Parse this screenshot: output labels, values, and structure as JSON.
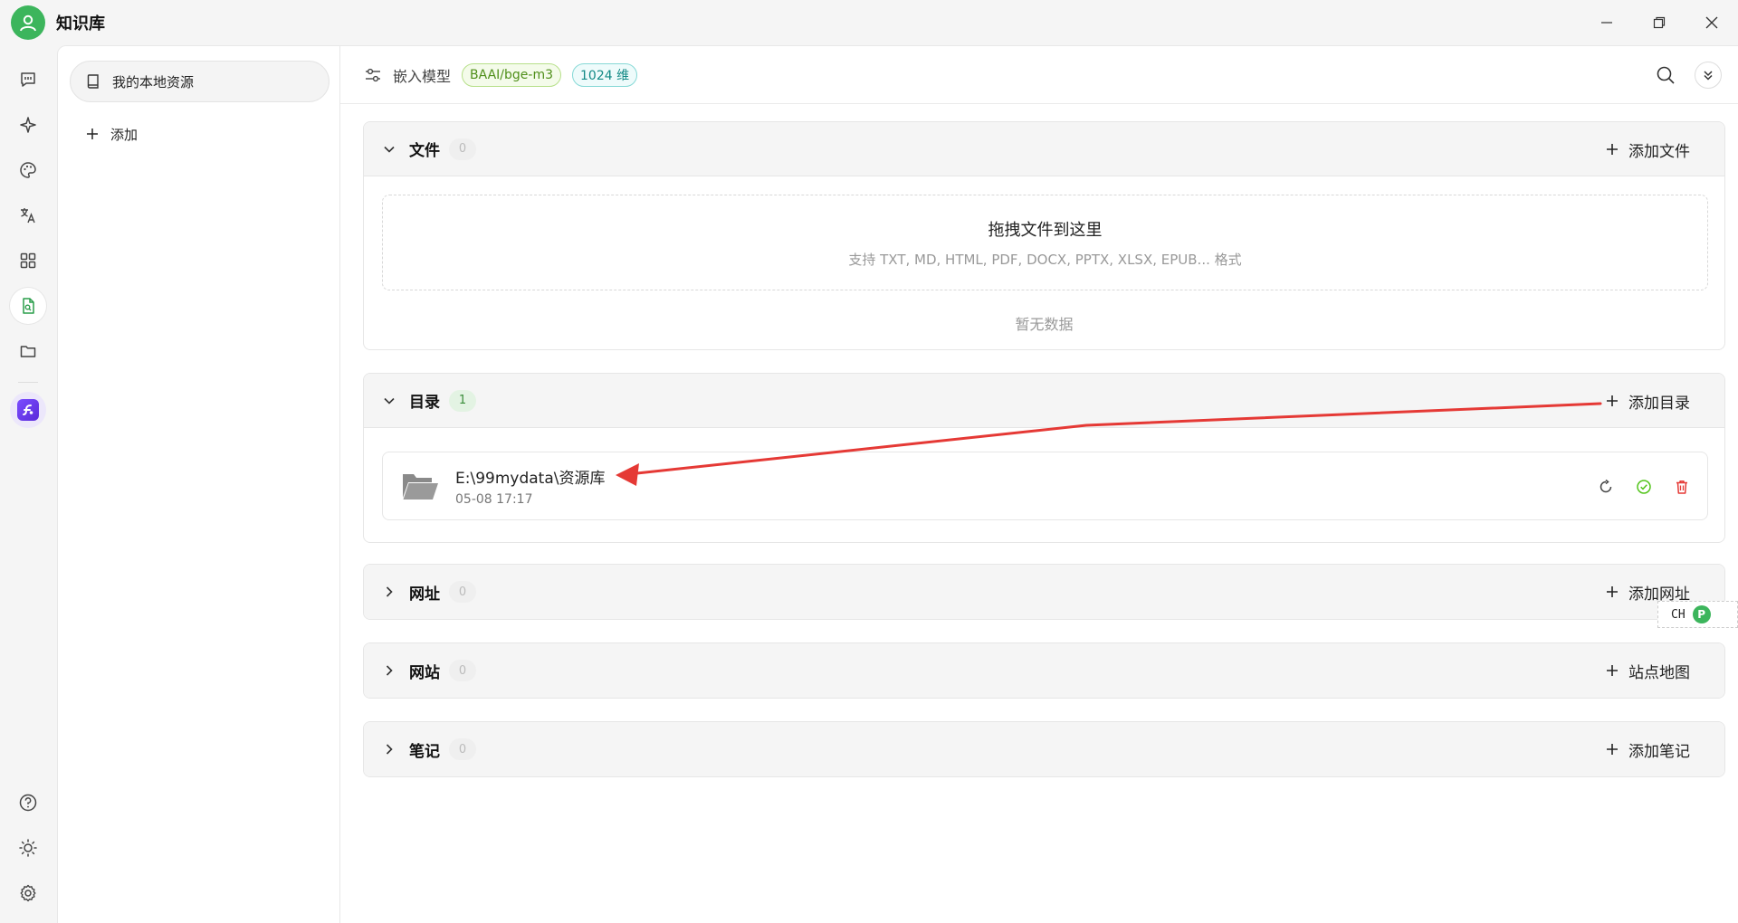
{
  "app": {
    "title": "知识库",
    "accent": "#3cb55c"
  },
  "rail": {
    "items": [
      "chat-icon",
      "sparkle-icon",
      "palette-icon",
      "translate-icon",
      "apps-grid-icon",
      "knowledge-base-icon",
      "folder-icon"
    ],
    "active": "knowledge-base-icon",
    "bottom": [
      "help-icon",
      "brightness-icon",
      "settings-icon"
    ]
  },
  "sidebar": {
    "knowledge_bases": [
      {
        "label": "我的本地资源"
      }
    ],
    "add_label": "添加"
  },
  "header": {
    "embed_label": "嵌入模型",
    "model_tag": "BAAI/bge-m3",
    "dim_tag": "1024 维"
  },
  "sections": {
    "files": {
      "title": "文件",
      "count": "0",
      "action": "添加文件",
      "dropzone_title": "拖拽文件到这里",
      "dropzone_sub": "支持 TXT, MD, HTML, PDF, DOCX, PPTX, XLSX, EPUB... 格式",
      "empty": "暂无数据"
    },
    "directories": {
      "title": "目录",
      "count": "1",
      "action": "添加目录",
      "items": [
        {
          "path": "E:\\99mydata\\资源库",
          "time": "05-08 17:17"
        }
      ]
    },
    "urls": {
      "title": "网址",
      "count": "0",
      "action": "添加网址"
    },
    "sites": {
      "title": "网站",
      "count": "0",
      "action": "站点地图"
    },
    "notes": {
      "title": "笔记",
      "count": "0",
      "action": "添加笔记"
    }
  },
  "ime": {
    "text": "CH"
  },
  "colors": {
    "annotation_arrow": "#e53935",
    "delete_icon": "#e53935",
    "status_ok": "#52c41a"
  }
}
